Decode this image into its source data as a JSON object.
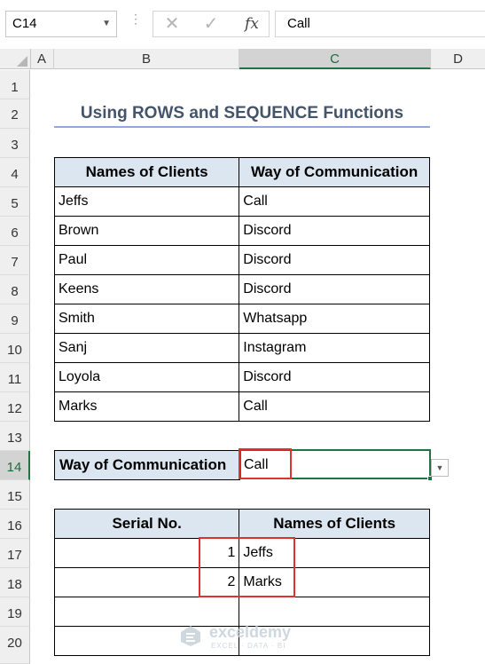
{
  "formula_bar": {
    "name_box": "C14",
    "cancel_glyph": "✕",
    "enter_glyph": "✓",
    "fx_label": "fx",
    "formula": "Call"
  },
  "columns": [
    "A",
    "B",
    "C",
    "D"
  ],
  "selected_column": "C",
  "rows": [
    "1",
    "2",
    "3",
    "4",
    "5",
    "6",
    "7",
    "8",
    "9",
    "10",
    "11",
    "12",
    "13",
    "14",
    "15",
    "16",
    "17",
    "18",
    "19",
    "20"
  ],
  "selected_row": "14",
  "title": "Using ROWS and SEQUENCE Functions",
  "clients_table": {
    "headers": [
      "Names of Clients",
      "Way of Communication"
    ],
    "rows": [
      [
        "Jeffs",
        "Call"
      ],
      [
        "Brown",
        "Discord"
      ],
      [
        "Paul",
        "Discord"
      ],
      [
        "Keens",
        "Discord"
      ],
      [
        "Smith",
        "Whatsapp"
      ],
      [
        "Sanj",
        "Instagram"
      ],
      [
        "Loyola",
        "Discord"
      ],
      [
        "Marks",
        "Call"
      ]
    ]
  },
  "criteria": {
    "label": "Way of Communication",
    "value": "Call"
  },
  "result_table": {
    "headers": [
      "Serial No.",
      "Names of Clients"
    ],
    "rows": [
      [
        "1",
        "Jeffs"
      ],
      [
        "2",
        "Marks"
      ],
      [
        "",
        ""
      ],
      [
        "",
        ""
      ]
    ]
  },
  "watermark": {
    "brand": "exceldemy",
    "tagline": "EXCEL · DATA · BI"
  },
  "colors": {
    "header_fill": "#dce6f1",
    "title_color": "#44546a",
    "highlight_border": "#e03030",
    "excel_green": "#217346"
  }
}
